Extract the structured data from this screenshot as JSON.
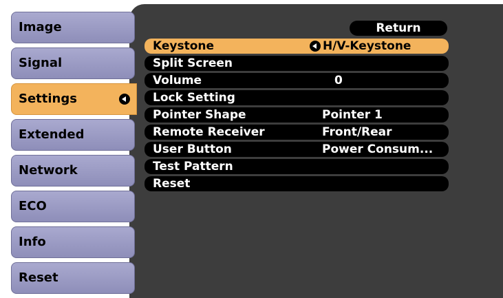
{
  "sidebar": {
    "tabs": [
      {
        "label": "Image"
      },
      {
        "label": "Signal"
      },
      {
        "label": "Settings"
      },
      {
        "label": "Extended"
      },
      {
        "label": "Network"
      },
      {
        "label": "ECO"
      },
      {
        "label": "Info"
      },
      {
        "label": "Reset"
      }
    ],
    "active_index": 2
  },
  "menu": {
    "return_label": "Return",
    "rows": [
      {
        "label": "Keystone",
        "value": "H/V-Keystone"
      },
      {
        "label": "Split Screen",
        "value": ""
      },
      {
        "label": "Volume",
        "value": "0"
      },
      {
        "label": "Lock Setting",
        "value": ""
      },
      {
        "label": "Pointer Shape",
        "value": "Pointer 1"
      },
      {
        "label": "Remote Receiver",
        "value": "Front/Rear"
      },
      {
        "label": "User Button",
        "value": "Power Consum..."
      },
      {
        "label": "Test Pattern",
        "value": ""
      },
      {
        "label": "Reset",
        "value": ""
      }
    ],
    "selected_index": 0
  },
  "colors": {
    "panel": "#3d3d3d",
    "tab": "#9c9cc4",
    "highlight": "#f3b35c",
    "row": "#000000",
    "text": "#ffffff"
  },
  "icons": {
    "enter": "enter-arrow-icon"
  }
}
